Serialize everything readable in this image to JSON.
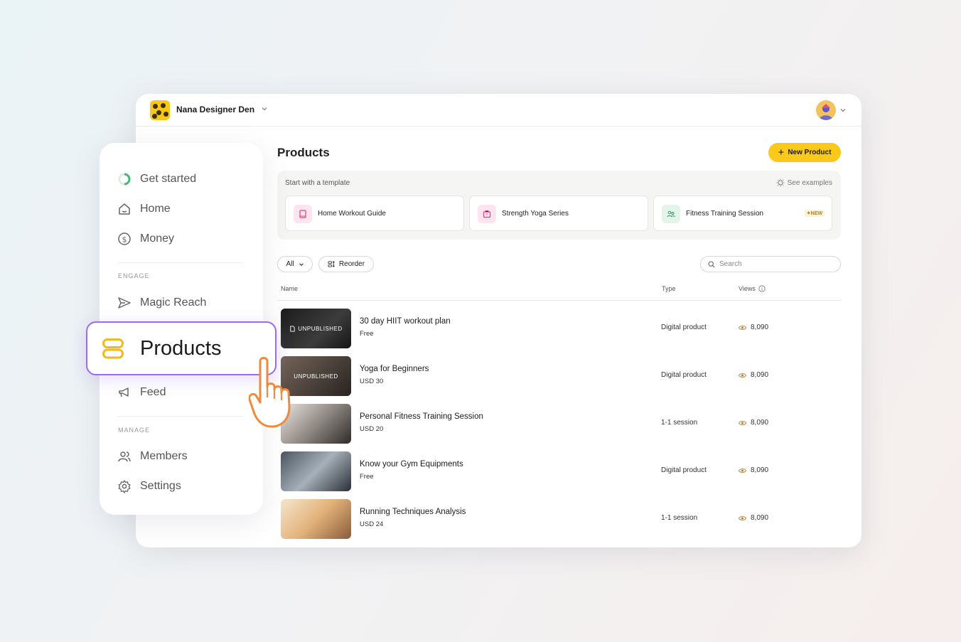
{
  "brand": {
    "name": "Nana Designer Den",
    "logo_icon": "bees-logo"
  },
  "header": {
    "avatar_icon": "user-avatar"
  },
  "sidebar": {
    "items_top": [
      {
        "label": "Get started",
        "icon": "progress-ring-icon"
      },
      {
        "label": "Home",
        "icon": "home-icon"
      },
      {
        "label": "Money",
        "icon": "dollar-circle-icon"
      }
    ],
    "section_engage": "ENGAGE",
    "magic_reach": "Magic Reach",
    "products": "Products",
    "feed": "Feed",
    "section_manage": "MANAGE",
    "members": "Members",
    "settings": "Settings"
  },
  "main": {
    "title": "Products",
    "new_button": "New Product",
    "templates": {
      "heading": "Start with a template",
      "see_examples": "See examples",
      "cards": [
        {
          "label": "Home Workout Guide",
          "icon": "book-icon",
          "color": "#fde4ef"
        },
        {
          "label": "Strength Yoga Series",
          "icon": "box-icon",
          "color": "#fde4ef"
        },
        {
          "label": "Fitness Training Session",
          "icon": "people-icon",
          "color": "#e3f5ea",
          "badge": "NEW"
        }
      ]
    },
    "filter": {
      "all_label": "All",
      "reorder_label": "Reorder",
      "search_placeholder": "Search"
    },
    "columns": {
      "name": "Name",
      "type": "Type",
      "views": "Views"
    },
    "rows": [
      {
        "name": "30 day HIIT workout plan",
        "price": "Free",
        "type": "Digital product",
        "views": "8,090",
        "status": "UNPUBLISHED"
      },
      {
        "name": "Yoga for Beginners",
        "price": "USD 30",
        "type": "Digital product",
        "views": "8,090",
        "status": "UNPUBLISHED"
      },
      {
        "name": "Personal Fitness Training Session",
        "price": "USD 20",
        "type": "1-1 session",
        "views": "8,090",
        "status": ""
      },
      {
        "name": "Know your Gym Equipments",
        "price": "Free",
        "type": "Digital product",
        "views": "8,090",
        "status": ""
      },
      {
        "name": "Running Techniques Analysis",
        "price": "USD 24",
        "type": "1-1 session",
        "views": "8,090",
        "status": ""
      }
    ]
  },
  "colors": {
    "accent": "#fbc91a",
    "highlight": "#9a6bf0",
    "hand": "#f08a3a"
  }
}
